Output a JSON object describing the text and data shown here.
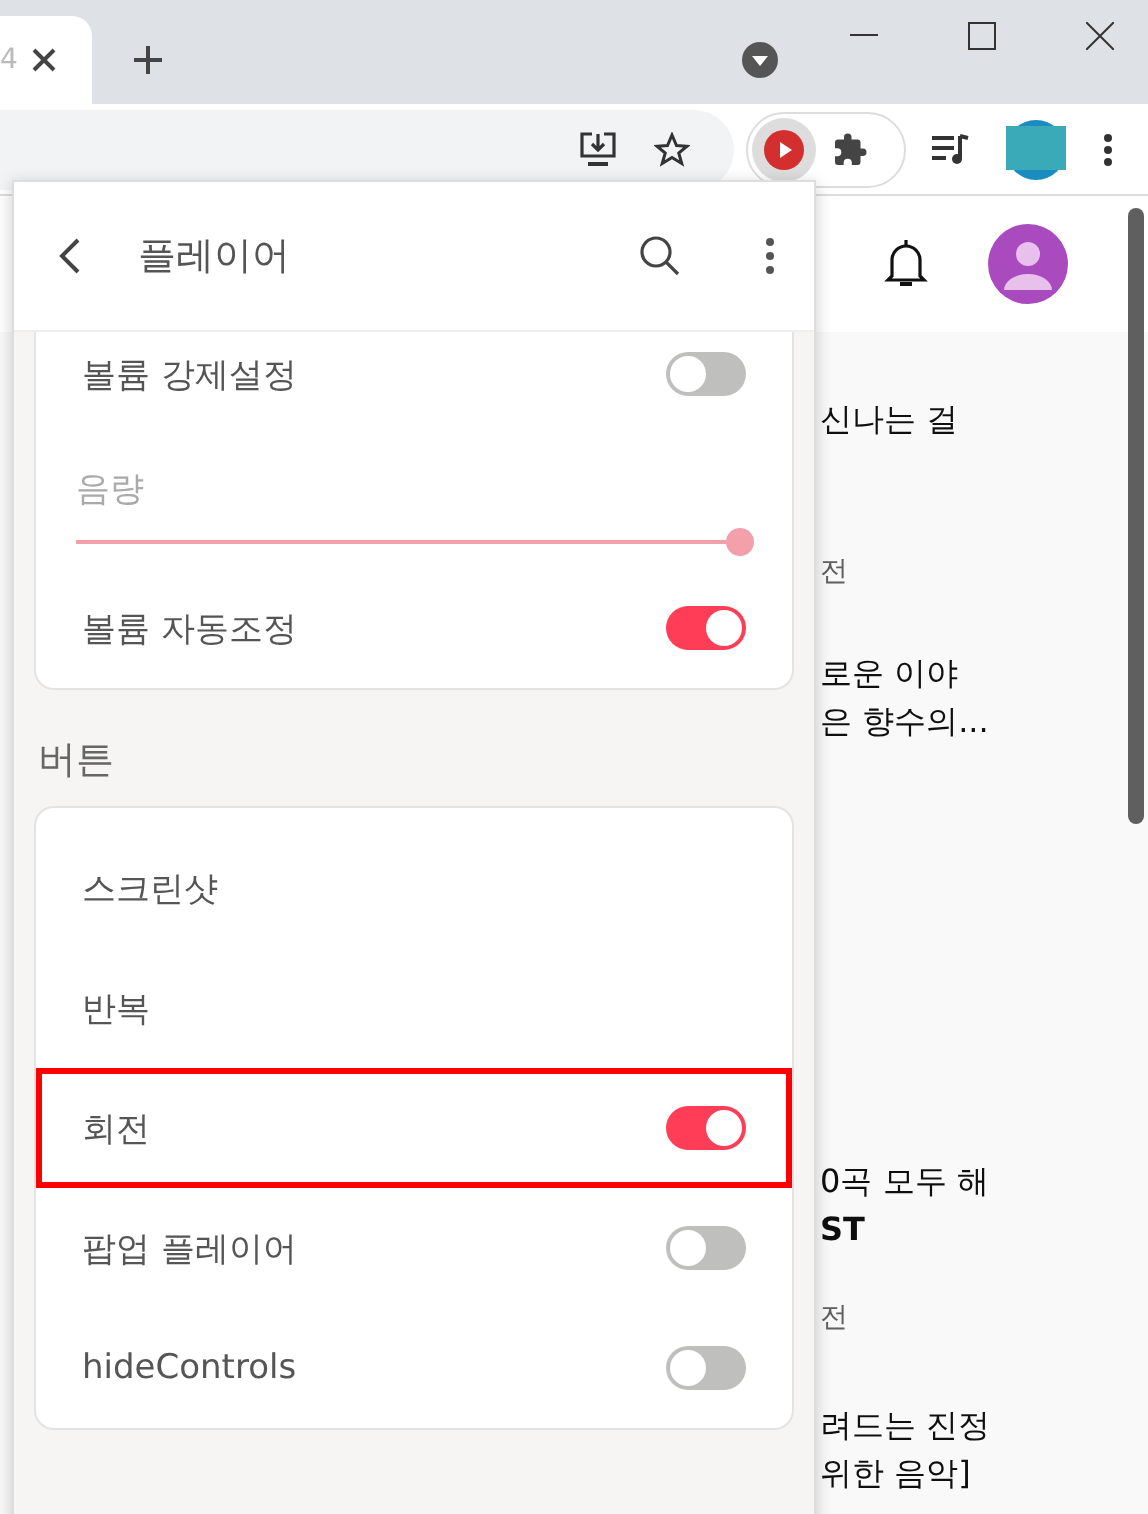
{
  "browser": {
    "tab": {
      "title": "4"
    }
  },
  "page": {
    "texts": [
      {
        "text": "신나는 걸",
        "kind": "title"
      },
      {
        "text": "전",
        "kind": "meta"
      },
      {
        "text": "로운 이야",
        "kind": "title"
      },
      {
        "text": "은 향수의...",
        "kind": "title"
      },
      {
        "text": "0곡 모두 해",
        "kind": "title"
      },
      {
        "text": "ST",
        "kind": "bold"
      },
      {
        "text": "전",
        "kind": "meta"
      },
      {
        "text": "려드는 진정",
        "kind": "title"
      },
      {
        "text": "위한 음악]",
        "kind": "title"
      }
    ]
  },
  "popup": {
    "title": "플레이어",
    "volume_card": [
      {
        "kind": "toggle",
        "label": "볼륨 강제설정",
        "on": false
      },
      {
        "kind": "slider",
        "label": "음량",
        "disabled": true,
        "level": 1
      },
      {
        "kind": "toggle",
        "label": "볼륨 자동조정",
        "on": true
      }
    ],
    "section": "버튼",
    "buttons_card": [
      {
        "kind": "plain",
        "label": "스크린샷",
        "highlighted": false
      },
      {
        "kind": "plain",
        "label": "반복",
        "highlighted": false
      },
      {
        "kind": "toggle",
        "label": "회전",
        "on": true,
        "highlighted": true
      },
      {
        "kind": "toggle",
        "label": "팝업 플레이어",
        "on": false,
        "highlighted": false
      },
      {
        "kind": "toggle",
        "label": "hideControls",
        "on": false,
        "highlighted": false
      }
    ]
  }
}
